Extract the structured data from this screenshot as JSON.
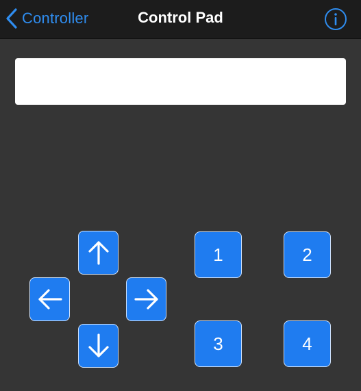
{
  "navbar": {
    "back_label": "Controller",
    "title": "Control Pad",
    "info_icon": "info-circle-icon",
    "back_icon": "chevron-left-icon"
  },
  "display": {
    "value": ""
  },
  "dpad": {
    "up_icon": "arrow-up-icon",
    "left_icon": "arrow-left-icon",
    "right_icon": "arrow-right-icon",
    "down_icon": "arrow-down-icon"
  },
  "numpad": {
    "one": "1",
    "two": "2",
    "three": "3",
    "four": "4"
  },
  "colors": {
    "background": "#353535",
    "navbar": "#1c1c1c",
    "accent": "#2f8df0",
    "button": "#1f7cf0"
  }
}
